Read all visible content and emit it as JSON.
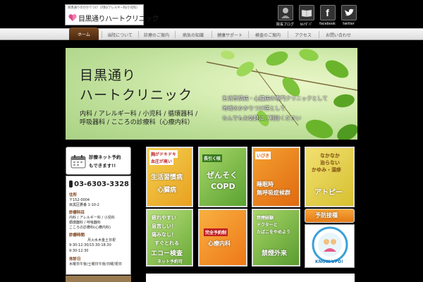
{
  "header": {
    "logo_tagline": "目黒通りのかかりつけ（内科/アレルギー科/小児科）",
    "logo_name": "目黒通りハートクリニック",
    "icons": [
      {
        "label": "院長ブログ",
        "icon": "doctor-icon"
      },
      {
        "label": "ｶﾙﾃﾀﾞﾊﾟ",
        "icon": "book-icon"
      },
      {
        "label": "facebook",
        "icon": "facebook-icon"
      },
      {
        "label": "twitter",
        "icon": "twitter-icon"
      }
    ]
  },
  "nav": {
    "items": [
      "ホーム",
      "当院について",
      "診療のご案内",
      "病気の知識",
      "健康サポート",
      "検査のご案内",
      "アクセス",
      "お問い合わせ"
    ],
    "active": "ホーム"
  },
  "hero": {
    "title_line1": "目黒通り",
    "title_line2": "ハートクリニック",
    "dept_line1": "内科 / アレルギー科 / 小児科 / 循環器科 /",
    "dept_line2": "呼吸器科 / こころの診療科（心療内科）",
    "msg_line1": "生活習慣病・心臓病の専門クリニックとして",
    "msg_line2": "地域のかかりつけ医として",
    "msg_line3": "なんでもお気軽にご相談ください"
  },
  "sidebar": {
    "net_reservation_line1": "診療ネット予約",
    "net_reservation_line2": "もできます!!",
    "phone": "03-6303-3328",
    "address_head": "住所",
    "postal": "〒152-0004",
    "address": "目黒区鷹番 1-10-2",
    "depts_head": "診療科目",
    "depts": [
      "内科 / アレルギー科 / 小児科",
      "循環器科 / 呼吸器科",
      "こころの診療科(心療内科)"
    ],
    "hours_head": "診療時間",
    "hours_days": "月火水木金土日祝",
    "hours_am": "9:30-12:30/15:30-18:30",
    "hours_pm": "9:30-12:30",
    "closed_head": "休診日",
    "closed": "水曜日午後/土曜日午後/日曜/祝日"
  },
  "tiles": {
    "t1": {
      "tag1": "胸がドキドキ",
      "tag2": "血圧が高い",
      "l1": "生活習慣病",
      "l2": "心臓病"
    },
    "t2": {
      "tag": "長引く咳",
      "l1": "ぜんそく",
      "l2": "COPD"
    },
    "t3": {
      "tag": "いびき",
      "l1": "睡眠時",
      "l2": "無呼吸症候群"
    },
    "t4": {
      "l1": "なかなか",
      "l2": "治らない",
      "l3": "かゆみ・湿疹",
      "l4": "アトピー"
    },
    "t5": {
      "l1": "疲れやすい",
      "l2": "息苦しい！",
      "l3": "痛みなし！",
      "l4": "すぐとれる",
      "l5": "エコー検査",
      "l6": "ネット予約可"
    },
    "t6": {
      "tag": "完全予約制",
      "l1": "心療内科"
    },
    "t7": {
      "l1": "禁煙経験",
      "l2": "ドクターと",
      "l3": "たばこをやめよう",
      "l4": "禁煙外来"
    },
    "t8": {
      "l1": "予防接種"
    },
    "t9": {
      "l1": "KNOW-VPD!"
    }
  },
  "colors": {
    "brown_nav": "#5a3414",
    "orange": "#e8901c",
    "green": "#6aaa38"
  }
}
